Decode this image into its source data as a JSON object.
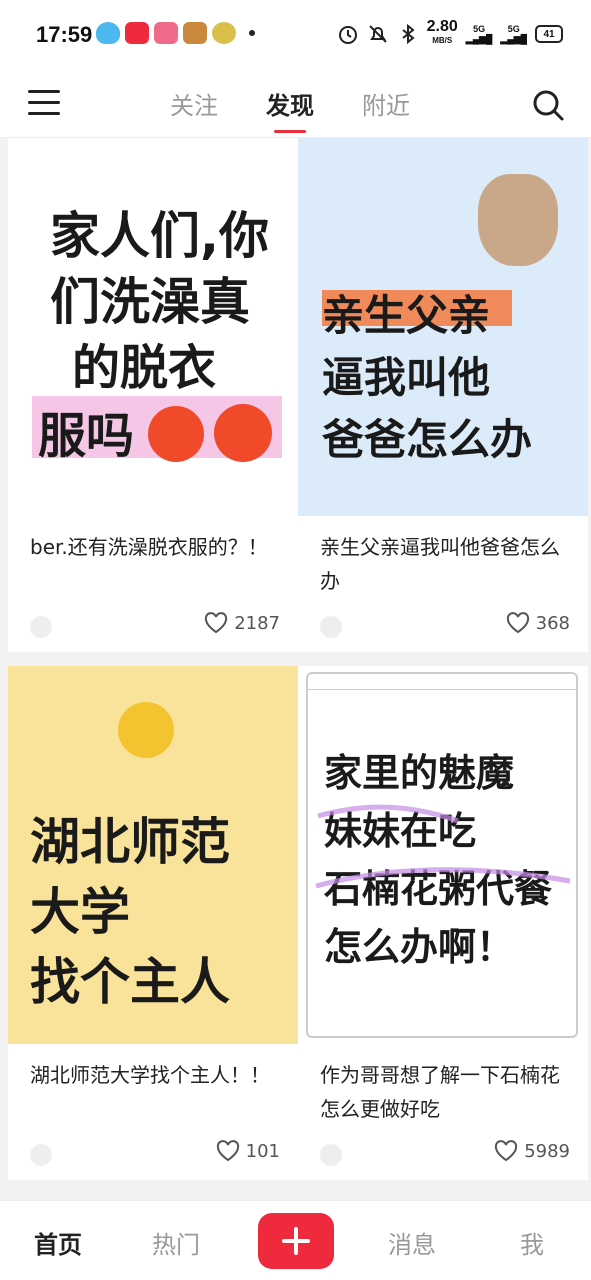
{
  "status_bar": {
    "time": "17:59",
    "speed": "2.80",
    "speed_unit": "MB/S",
    "net1": "5G",
    "net2": "5G",
    "battery": "41"
  },
  "top_nav": {
    "tabs": [
      {
        "label": "关注",
        "active": false
      },
      {
        "label": "发现",
        "active": true
      },
      {
        "label": "附近",
        "active": false
      }
    ]
  },
  "feed": {
    "cards": [
      {
        "image_lines": [
          "家人们,你",
          "们洗澡真",
          "的脱衣",
          "服吗"
        ],
        "title": "ber.还有洗澡脱衣服的？！",
        "likes": "2187"
      },
      {
        "image_lines": [
          "亲生父亲",
          "逼我叫他",
          "爸爸怎么办"
        ],
        "title": "亲生父亲逼我叫他爸爸怎么办",
        "likes": "368"
      },
      {
        "image_lines": [
          "湖北师范",
          "大学",
          "找个主人"
        ],
        "title": "湖北师范大学找个主人！！",
        "likes": "101"
      },
      {
        "image_lines": [
          "家里的魅魔",
          "妹妹在吃",
          "石楠花粥代餐",
          "怎么办啊！"
        ],
        "title": "作为哥哥想了解一下石楠花怎么更做好吃",
        "likes": "5989"
      }
    ]
  },
  "bottom_nav": {
    "items": [
      "首页",
      "热门",
      "消息",
      "我"
    ]
  },
  "colors": {
    "accent": "#e8303c",
    "card2_bg": "#dcebf9",
    "card3_bg": "#f9e39a"
  }
}
